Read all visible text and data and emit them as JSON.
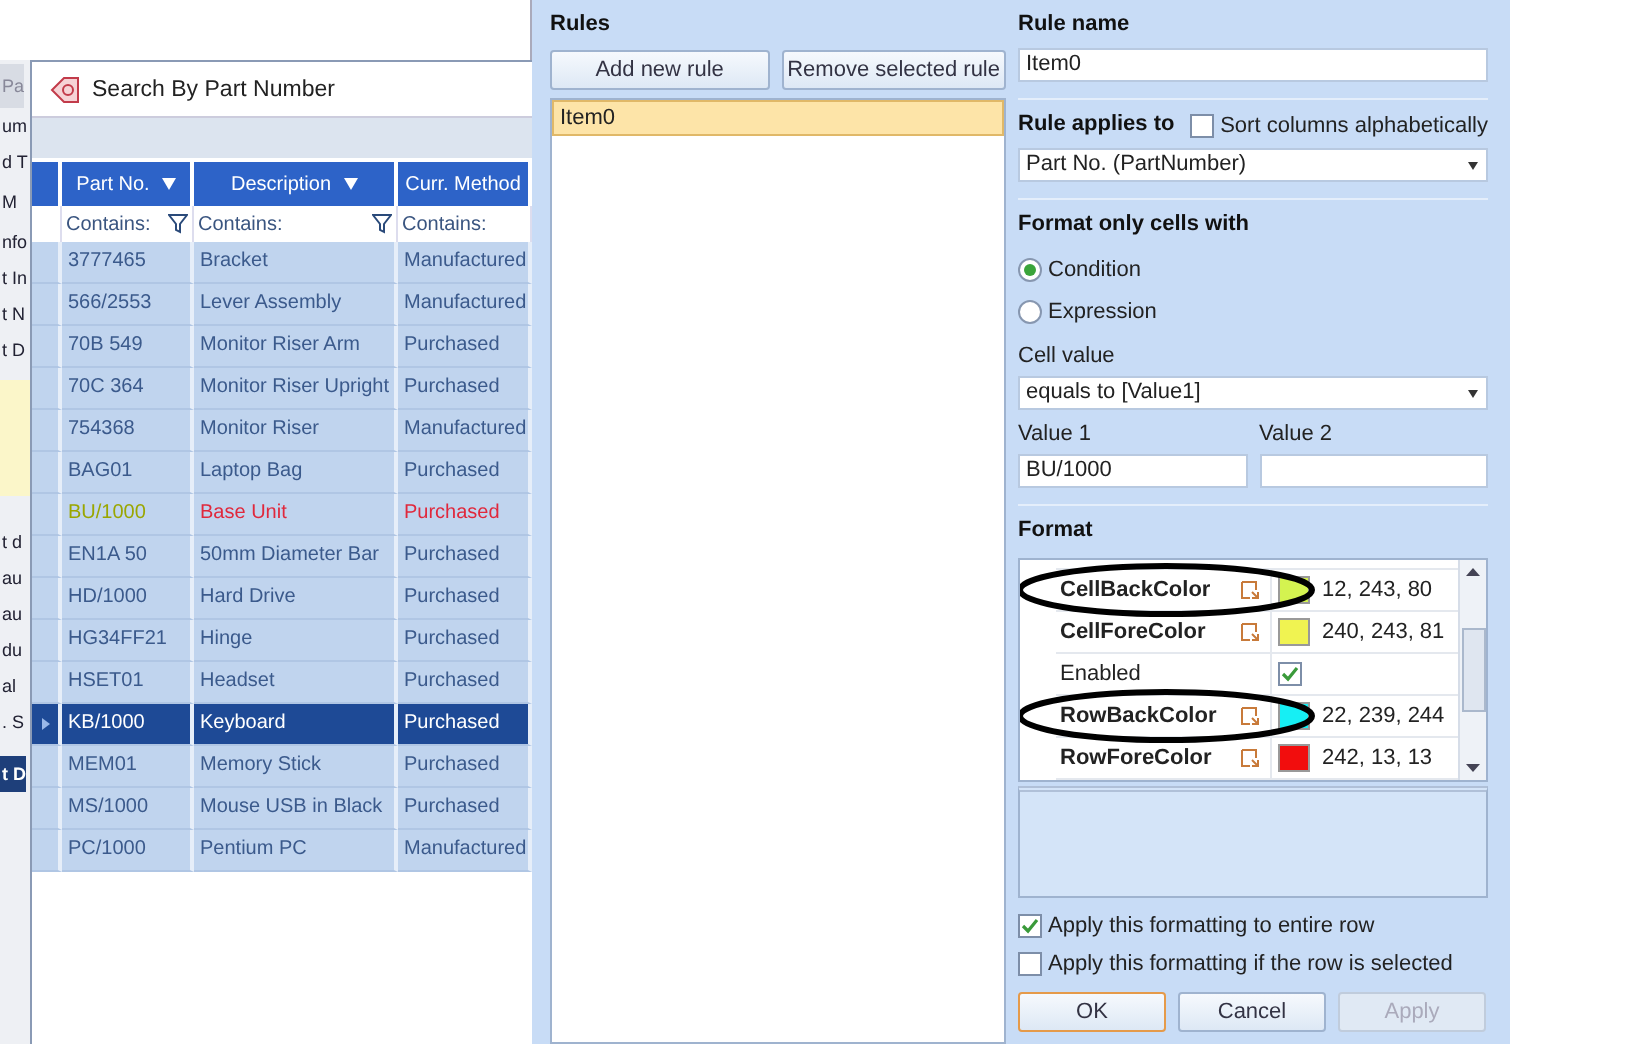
{
  "background_window": {
    "fragments_top": [
      {
        "text": "Pa",
        "kind": "tab"
      },
      {
        "text": "um",
        "kind": "text"
      },
      {
        "text": "d T",
        "kind": "text"
      },
      {
        "text": "M",
        "kind": "button"
      },
      {
        "text": "nfo",
        "kind": "text"
      },
      {
        "text": "t In",
        "kind": "text"
      },
      {
        "text": "t N",
        "kind": "text"
      },
      {
        "text": "t D",
        "kind": "text"
      }
    ],
    "fragments_bottom": [
      {
        "text": "t d",
        "kind": "text"
      },
      {
        "text": "au",
        "kind": "text"
      },
      {
        "text": "au",
        "kind": "text"
      },
      {
        "text": "du",
        "kind": "text"
      },
      {
        "text": "al",
        "kind": "text"
      },
      {
        "text": ". S",
        "kind": "text"
      },
      {
        "text": "t D",
        "kind": "bar"
      }
    ]
  },
  "search_dialog": {
    "title": "Search By Part Number",
    "columns": [
      {
        "label": "Part No.",
        "filter": "Contains:",
        "cut": false
      },
      {
        "label": "Description",
        "filter": "Contains:",
        "cut": false
      },
      {
        "label": "Curr. Method",
        "filter": "Contains:",
        "cut": true
      }
    ],
    "rows": [
      {
        "part_no": "3777465",
        "description": "Bracket",
        "method": "Manufactured",
        "selected": false,
        "formatted": false
      },
      {
        "part_no": "566/2553",
        "description": "Lever Assembly",
        "method": "Manufactured",
        "selected": false,
        "formatted": false
      },
      {
        "part_no": "70B 549",
        "description": "Monitor Riser Arm",
        "method": "Purchased",
        "selected": false,
        "formatted": false
      },
      {
        "part_no": "70C 364",
        "description": "Monitor Riser Upright",
        "method": "Purchased",
        "selected": false,
        "formatted": false
      },
      {
        "part_no": "754368",
        "description": "Monitor Riser",
        "method": "Manufactured",
        "selected": false,
        "formatted": false
      },
      {
        "part_no": "BAG01",
        "description": "Laptop Bag",
        "method": "Purchased",
        "selected": false,
        "formatted": false
      },
      {
        "part_no": "BU/1000",
        "description": "Base Unit",
        "method": "Purchased",
        "selected": false,
        "formatted": true
      },
      {
        "part_no": "EN1A 50",
        "description": "50mm Diameter Bar",
        "method": "Purchased",
        "selected": false,
        "formatted": false
      },
      {
        "part_no": "HD/1000",
        "description": "Hard Drive",
        "method": "Purchased",
        "selected": false,
        "formatted": false
      },
      {
        "part_no": "HG34FF21",
        "description": "Hinge",
        "method": "Purchased",
        "selected": false,
        "formatted": false
      },
      {
        "part_no": "HSET01",
        "description": "Headset",
        "method": "Purchased",
        "selected": false,
        "formatted": false
      },
      {
        "part_no": "KB/1000",
        "description": "Keyboard",
        "method": "Purchased",
        "selected": true,
        "formatted": false
      },
      {
        "part_no": "MEM01",
        "description": "Memory Stick",
        "method": "Purchased",
        "selected": false,
        "formatted": false
      },
      {
        "part_no": "MS/1000",
        "description": "Mouse USB in Black",
        "method": "Purchased",
        "selected": false,
        "formatted": false
      },
      {
        "part_no": "PC/1000",
        "description": "Pentium PC",
        "method": "Manufactured",
        "selected": false,
        "formatted": false
      }
    ]
  },
  "rules": {
    "title": "Rules",
    "buttons": [
      "Add new rule",
      "Remove selected rule"
    ],
    "items": [
      {
        "label": "Item0",
        "selected": true
      }
    ]
  },
  "editor": {
    "rule_name_label": "Rule name",
    "rule_name": "Item0",
    "applies_to_label": "Rule applies to",
    "sort_checkbox": {
      "label": "Sort columns alphabetically",
      "checked": false
    },
    "applies_to": "Part No. (PartNumber)",
    "format_only_label": "Format only cells with",
    "radios": [
      {
        "label": "Condition",
        "selected": true
      },
      {
        "label": "Expression",
        "selected": false
      }
    ],
    "cell_value_label": "Cell value",
    "cell_value": "equals to [Value1]",
    "value1_label": "Value 1",
    "value1": "BU/1000",
    "value2_label": "Value 2",
    "format_label": "Format",
    "properties": [
      {
        "name": "CellBackColor",
        "kind": "color",
        "color": "#d4f350",
        "value": "12, 243, 80",
        "circled": true
      },
      {
        "name": "CellForeColor",
        "kind": "color",
        "color": "#f0f351",
        "value": "240, 243, 81",
        "circled": false
      },
      {
        "name": "Enabled",
        "kind": "bool",
        "checked": true,
        "circled": false
      },
      {
        "name": "RowBackColor",
        "kind": "color",
        "color": "#16eff4",
        "value": "22, 239, 244",
        "circled": true
      },
      {
        "name": "RowForeColor",
        "kind": "color",
        "color": "#f20d0d",
        "value": "242, 13, 13",
        "circled": false
      }
    ],
    "options": [
      {
        "label": "Apply this formatting to entire row",
        "checked": true
      },
      {
        "label": "Apply this formatting if the row is selected",
        "checked": false
      }
    ],
    "buttons": [
      {
        "label": "OK",
        "kind": "default"
      },
      {
        "label": "Cancel",
        "kind": "normal"
      },
      {
        "label": "Apply",
        "kind": "disabled"
      }
    ]
  }
}
